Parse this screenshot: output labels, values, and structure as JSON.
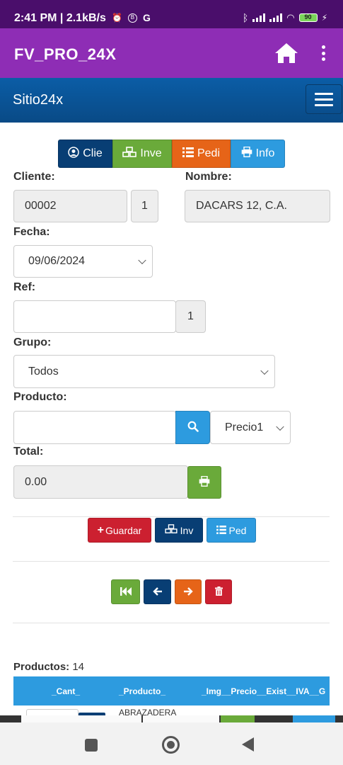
{
  "status": {
    "time": "2:41 PM | 2.1kB/s",
    "g_label": "G",
    "battery": "90"
  },
  "appbar": {
    "title": "FV_PRO_24X"
  },
  "site": {
    "brand": "Sitio24x"
  },
  "tabs": [
    {
      "label": "Clie"
    },
    {
      "label": "Inve"
    },
    {
      "label": "Pedi"
    },
    {
      "label": "Info"
    }
  ],
  "form": {
    "cliente_label": "Cliente:",
    "cliente_value": "00002",
    "cliente_num": "1",
    "nombre_label": "Nombre:",
    "nombre_value": "DACARS 12, C.A.",
    "fecha_label": "Fecha:",
    "fecha_value": "09/06/2024",
    "ref_label": "Ref:",
    "ref_value": "",
    "ref_num": "1",
    "grupo_label": "Grupo:",
    "grupo_value": "Todos",
    "producto_label": "Producto:",
    "producto_value": "",
    "precio_value": "Precio1",
    "total_label": "Total:",
    "total_value": "0.00"
  },
  "actions": {
    "guardar": "Guardar",
    "inv": "Inv",
    "ped": "Ped"
  },
  "products": {
    "label": "Productos:",
    "count": "14",
    "headers": [
      "_Cant_",
      "_Producto_",
      "_Img__Precio__Exist__IVA__G"
    ],
    "first_row_product": "ABRAZADERA"
  },
  "colors": {
    "status_bar": "#4a0e6b",
    "app_bar": "#8e2db5",
    "site_bar": "#0b5da6",
    "blue_dark": "#083e74",
    "green": "#6aaa3a",
    "orange": "#e66418",
    "light_blue": "#2d9bdf",
    "red": "#cc2030"
  }
}
